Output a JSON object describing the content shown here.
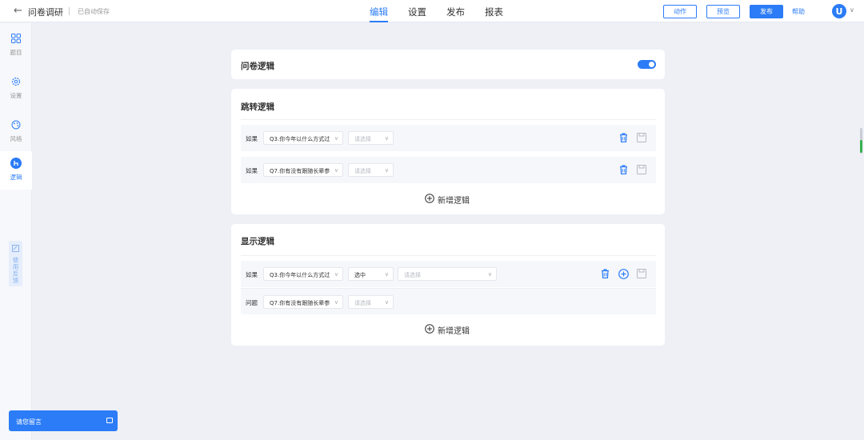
{
  "header": {
    "back_label": "←",
    "title": "问卷调研",
    "autosave": "已自动保存",
    "tabs": [
      {
        "label": "编辑",
        "active": true
      },
      {
        "label": "设置",
        "active": false
      },
      {
        "label": "发布",
        "active": false
      },
      {
        "label": "报表",
        "active": false
      }
    ],
    "buttons": {
      "action": "动作",
      "preview": "预览",
      "publish": "发布"
    },
    "help": "帮助",
    "avatar": "U"
  },
  "sidebar": {
    "items": [
      {
        "label": "题目",
        "icon": "grid-icon",
        "active": false
      },
      {
        "label": "设置",
        "icon": "gear-icon",
        "active": false
      },
      {
        "label": "风格",
        "icon": "palette-icon",
        "active": false
      },
      {
        "label": "逻辑",
        "icon": "logic-icon",
        "active": true
      }
    ],
    "feedback": "使用反馈"
  },
  "questionnaire_logic": {
    "title": "问卷逻辑",
    "enabled": true
  },
  "jump_logic": {
    "title": "跳转逻辑",
    "rows": [
      {
        "label": "如果",
        "question": "Q3.你今年以什么方式过",
        "placeholder": "请选择"
      },
      {
        "label": "如果",
        "question": "Q7.你有没有跟随长辈参",
        "placeholder": "请选择"
      }
    ],
    "add_label": "新增逻辑"
  },
  "display_logic": {
    "title": "显示逻辑",
    "condition": {
      "label": "如果",
      "question": "Q3.你今年以什么方式过",
      "operator": "选中",
      "placeholder": "请选择"
    },
    "target": {
      "label": "问题",
      "question": "Q7.你有没有跟随长辈参",
      "placeholder": "请选择"
    },
    "add_label": "新增逻辑"
  },
  "message_box": {
    "label": "请您留言"
  },
  "colors": {
    "accent": "#2b7cf6",
    "background": "#eef0f6",
    "row_bg": "#f5f7fb"
  }
}
